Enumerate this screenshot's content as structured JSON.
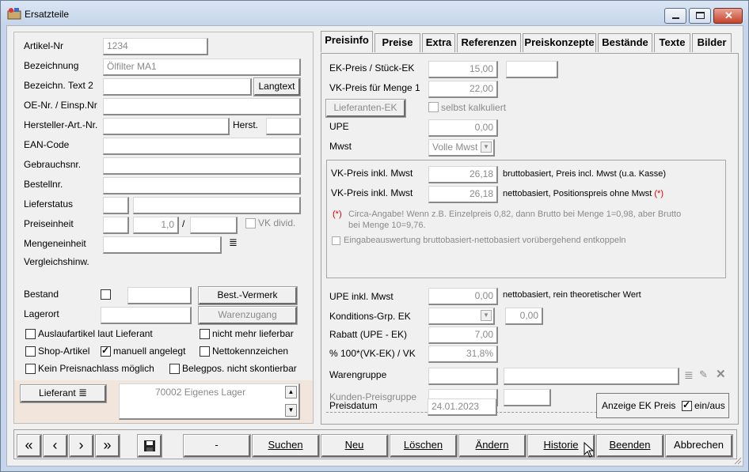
{
  "window": {
    "title": "Ersatzteile"
  },
  "left": {
    "artikel_nr_label": "Artikel-Nr",
    "artikel_nr_value": "1234",
    "bezeichnung_label": "Bezeichnung",
    "bezeichnung_value": "Ölfilter MA1",
    "bezeichn_text2_label": "Bezeichn. Text 2",
    "langtext_button": "Langtext",
    "oe_nr_label": "OE-Nr. / Einsp.Nr",
    "hersteller_art_label": "Hersteller-Art.-Nr.",
    "herst_button": "Herst.",
    "ean_label": "EAN-Code",
    "gebrauchsnr_label": "Gebrauchsnr.",
    "bestellnr_label": "Bestellnr.",
    "lieferstatus_label": "Lieferstatus",
    "preiseinheit_label": "Preiseinheit",
    "preiseinheit_value": "1,0",
    "preiseinheit_sep": "/",
    "vk_divid_label": "VK divid.",
    "mengeneinheit_label": "Mengeneinheit",
    "vergleichshinw_label": "Vergleichshinw.",
    "bestand_label": "Bestand",
    "best_vermerk_button": "Best.-Vermerk",
    "lagerort_label": "Lagerort",
    "warenzugang_button": "Warenzugang",
    "auslaufartikel_label": "Auslaufartikel laut Lieferant",
    "nicht_mehr_lieferbar_label": "nicht mehr lieferbar",
    "shop_artikel_label": "Shop-Artikel",
    "manuell_angelegt_label": "manuell angelegt",
    "nettokennzeichen_label": "Nettokennzeichen",
    "kein_preisnachlass_label": "Kein Preisnachlass möglich",
    "belegpos_label": "Belegpos. nicht skontierbar",
    "lieferant_button": "Lieferant",
    "lieferant_value": "70002 Eigenes Lager"
  },
  "tabs": [
    "Preisinfo",
    "Preise",
    "Extra",
    "Referenzen",
    "Preiskonzepte",
    "Bestände",
    "Texte",
    "Bilder"
  ],
  "preisinfo": {
    "ek_preis_label": "EK-Preis  / Stück-EK",
    "ek_preis_value": "15,00",
    "vk_menge1_label": "VK-Preis für Menge 1",
    "vk_menge1_value": "22,00",
    "lieferanten_ek_button": "Lieferanten-EK",
    "selbst_kalkuliert_label": "selbst kalkuliert",
    "upe_label": "UPE",
    "upe_value": "0,00",
    "mwst_label": "Mwst",
    "mwst_value": "Volle Mwst",
    "vk_inkl_mwst1_label": "VK-Preis inkl. Mwst",
    "vk_inkl_mwst1_value": "26,18",
    "vk_inkl_mwst1_note": "bruttobasiert, Preis incl. Mwst (u.a. Kasse)",
    "vk_inkl_mwst2_label": "VK-Preis inkl. Mwst",
    "vk_inkl_mwst2_value": "26,18",
    "vk_inkl_mwst2_note": "nettobasiert, Positionspreis ohne Mwst",
    "asterisk": "(*)",
    "circa_line1": "Circa-Angabe! Wenn z.B. Einzelpreis 0,82, dann Brutto bei Menge 1=0,98, aber Brutto",
    "circa_line2": "bei Menge 10=9,76.",
    "eingabe_label": "Eingabeauswertung bruttobasiert-nettobasiert vorübergehend entkoppeln",
    "upe_inkl_label": "UPE inkl. Mwst",
    "upe_inkl_value": "0,00",
    "upe_inkl_note": "nettobasiert, rein theoretischer Wert",
    "konditions_label": "Konditions-Grp. EK",
    "konditions_value": "0,00",
    "rabatt_label": "Rabatt (UPE - EK)",
    "rabatt_value": "7,00",
    "prozent_label": "% 100*(VK-EK) / VK",
    "prozent_value": "31,8%",
    "warengruppe_label": "Warengruppe",
    "kunden_preisgruppe_label": "Kunden-Preisgruppe",
    "preisdatum_label": "Preisdatum",
    "preisdatum_value": "24.01.2023",
    "anzeige_ek_label": "Anzeige EK Preis",
    "ein_aus_label": "ein/aus"
  },
  "bottom": {
    "dash_button": "-",
    "suchen": "Suchen",
    "neu": "Neu",
    "loeschen": "Löschen",
    "aendern": "Ändern",
    "historie": "Historie",
    "beenden": "Beenden",
    "abbrechen": "Abbrechen"
  },
  "colors": {
    "lieferant_bg": "#f2e6dc",
    "accent_red": "#d00000"
  }
}
